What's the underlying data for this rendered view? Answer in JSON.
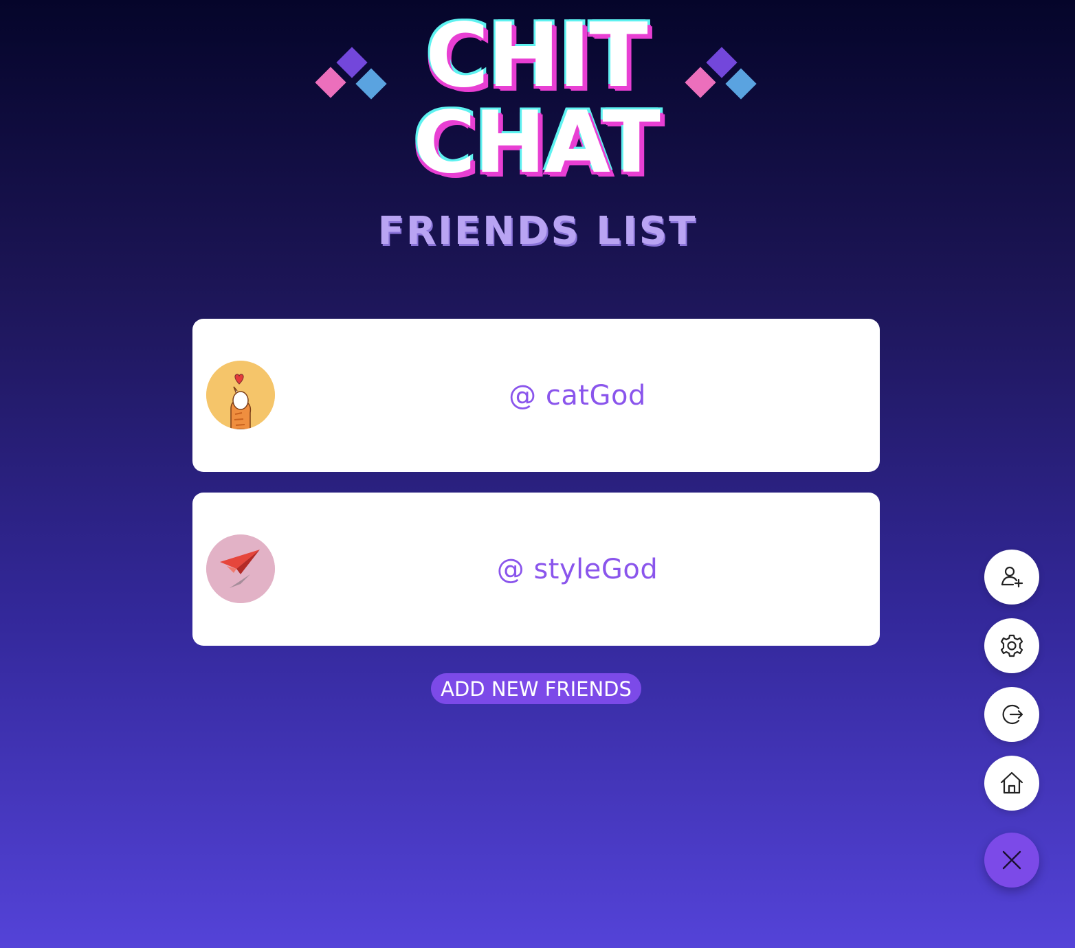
{
  "app": {
    "logo_line1": "CHIT",
    "logo_line2": "CHAT",
    "page_heading": "FRIENDS LIST"
  },
  "friends": [
    {
      "handle": "@ catGod",
      "avatar": "cat-paw-heart-icon",
      "avatar_bg": "#f5c56a"
    },
    {
      "handle": "@ styleGod",
      "avatar": "paper-plane-icon",
      "avatar_bg": "#e2b2c6"
    }
  ],
  "actions": {
    "add_friends_label": "ADD NEW FRIENDS"
  },
  "fab_menu": [
    {
      "icon": "add-user-icon"
    },
    {
      "icon": "gear-icon"
    },
    {
      "icon": "logout-icon"
    },
    {
      "icon": "home-icon"
    },
    {
      "icon": "close-icon"
    }
  ],
  "colors": {
    "accent": "#7c4ae8",
    "handle_text": "#8a55ec",
    "heading": "#b9a4f3",
    "logo_pink": "#e83fd3",
    "logo_cyan": "#5ef2f0"
  }
}
